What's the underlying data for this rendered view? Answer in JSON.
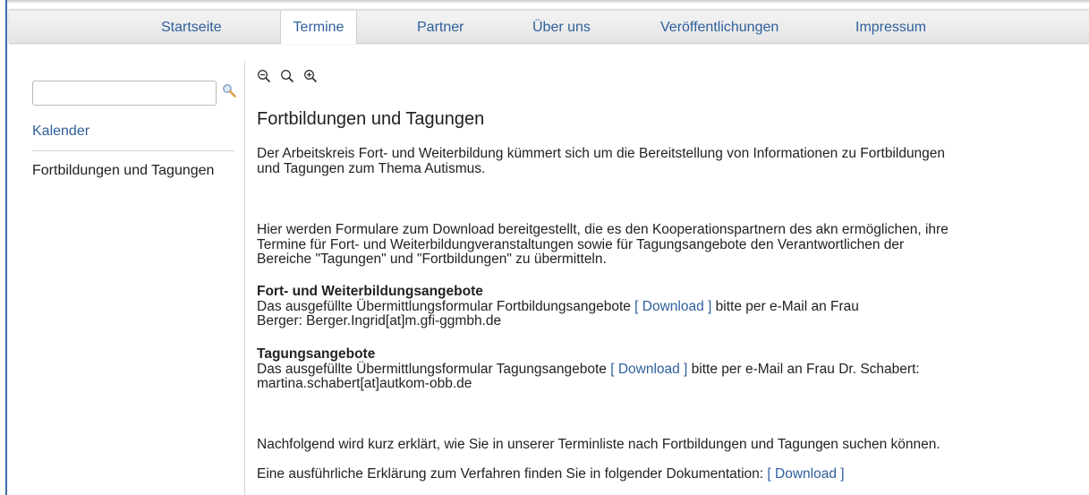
{
  "nav": {
    "items": [
      {
        "label": "Startseite"
      },
      {
        "label": "Termine"
      },
      {
        "label": "Partner"
      },
      {
        "label": "Über uns"
      },
      {
        "label": "Veröffentlichungen"
      },
      {
        "label": "Impressum"
      }
    ],
    "active": "Termine"
  },
  "sidebar": {
    "search_value": "",
    "link_kalender": "Kalender",
    "item_fortbildungen": "Fortbildungen und Tagungen"
  },
  "toolbar": {
    "zoom_out_icon": "zoom-out-icon",
    "zoom_reset_icon": "magnifier-icon",
    "zoom_in_icon": "zoom-in-icon"
  },
  "main": {
    "title": "Fortbildungen und Tagungen",
    "intro_line1": "Der Arbeitskreis Fort- und Weiterbildung kümmert sich um die Bereitstellung von Informationen zu Fortbildungen",
    "intro_line2": "und Tagungen zum Thema Autismus.",
    "forms_line1": "Hier werden Formulare zum Download bereitgestellt, die es den Kooperationspartnern des akn ermöglichen, ihre",
    "forms_line2": "Termine für Fort- und Weiterbildungveranstaltungen sowie für Tagungsangebote den Verantwortlichen der",
    "forms_line3": "Bereiche \"Tagungen\" und \"Fortbildungen\" zu übermitteln.",
    "fw_heading": "Fort- und Weiterbildungsangebote",
    "fw_text_before": "Das ausgefüllte Übermittlungsformular Fortbildungsangebote ",
    "fw_link": "[ Download ]",
    "fw_text_after": " bitte per e-Mail an Frau",
    "fw_line2": "Berger: Berger.Ingrid[at]m.gfi-ggmbh.de",
    "tg_heading": "Tagungsangebote",
    "tg_text_before": "Das ausgefüllte Übermittlungsformular Tagungsangebote ",
    "tg_link": "[ Download ]",
    "tg_text_after": " bitte per e-Mail an Frau Dr. Schabert:",
    "tg_line2": "martina.schabert[at]autkom-obb.de",
    "follow_text": "Nachfolgend wird kurz erklärt, wie Sie in unserer Terminliste nach Fortbildungen und Tagungen suchen können.",
    "doc_text_before": "Eine ausführliche Erklärung zum Verfahren finden Sie in folgender Dokumentation: ",
    "doc_link": "[ Download ]"
  },
  "colors": {
    "link": "#2e5f9c",
    "frame": "#3d6aa8"
  }
}
